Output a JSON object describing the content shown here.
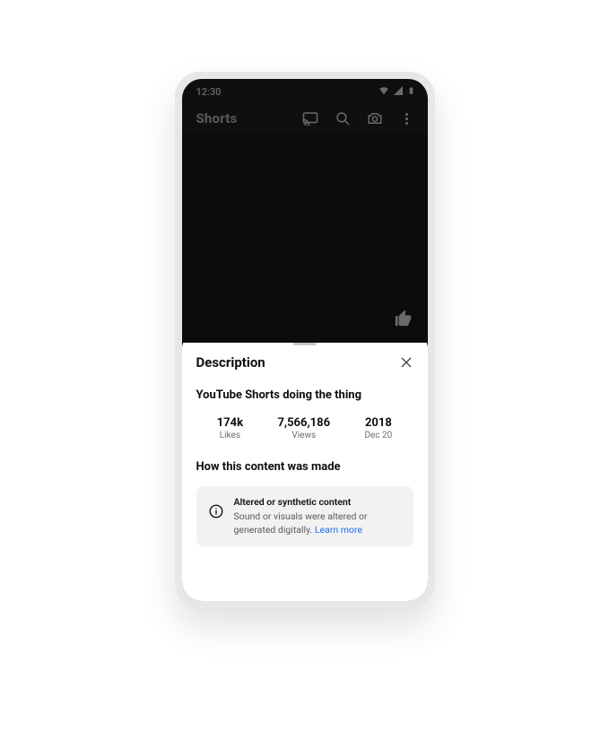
{
  "statusBar": {
    "time": "12:30"
  },
  "header": {
    "title": "Shorts"
  },
  "sheet": {
    "title": "Description",
    "videoTitle": "YouTube Shorts doing the thing",
    "stats": {
      "likes": {
        "value": "174k",
        "label": "Likes"
      },
      "views": {
        "value": "7,566,186",
        "label": "Views"
      },
      "date": {
        "value": "2018",
        "label": "Dec 20"
      }
    },
    "sectionHeading": "How this content was made",
    "infoCard": {
      "title": "Altered or synthetic content",
      "body": "Sound or visuals were altered or generated digitally. ",
      "linkText": "Learn more"
    }
  }
}
